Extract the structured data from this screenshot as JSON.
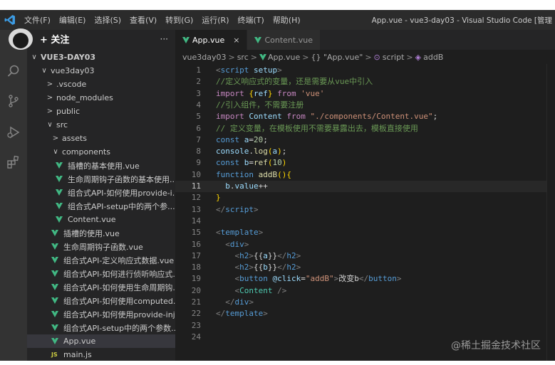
{
  "titlebar": {
    "menu": [
      "文件(F)",
      "编辑(E)",
      "选择(S)",
      "查看(V)",
      "转到(G)",
      "运行(R)",
      "终端(T)",
      "帮助(H)"
    ],
    "window_title": "App.vue - vue3-day03 - Visual Studio Code [管理"
  },
  "overlay": {
    "follow_label": "+ 关注"
  },
  "colors": {
    "vue_green": "#41b883",
    "accent": "#3c9be3",
    "background": "#1e1e1e"
  },
  "sidebar": {
    "more_label": "···",
    "rows": [
      {
        "label": "VUE3-DAY03",
        "chev": "∨",
        "indent": 4,
        "bold": true
      },
      {
        "label": "vue3day03",
        "chev": "∨",
        "indent": 18
      },
      {
        "label": ".vscode",
        "chev": ">",
        "indent": 26
      },
      {
        "label": "node_modules",
        "chev": ">",
        "indent": 26
      },
      {
        "label": "public",
        "chev": ">",
        "indent": 26
      },
      {
        "label": "src",
        "chev": "∨",
        "indent": 26
      },
      {
        "label": "assets",
        "chev": ">",
        "indent": 34
      },
      {
        "label": "components",
        "chev": "∨",
        "indent": 34
      },
      {
        "label": "插槽的基本使用.vue",
        "icon": "vue",
        "indent": 40
      },
      {
        "label": "生命周期钩子函数的基本使用...",
        "icon": "vue",
        "indent": 40
      },
      {
        "label": "组合式API-如何使用provide-i...",
        "icon": "vue",
        "indent": 40
      },
      {
        "label": "组合式API-setup中的两个参...",
        "icon": "vue",
        "indent": 40
      },
      {
        "label": "Content.vue",
        "icon": "vue",
        "indent": 40
      },
      {
        "label": "插槽的使用.vue",
        "icon": "vue",
        "indent": 34
      },
      {
        "label": "生命周期钩子函数.vue",
        "icon": "vue",
        "indent": 34
      },
      {
        "label": "组合式API-定义响应式数据.vue",
        "icon": "vue",
        "indent": 34
      },
      {
        "label": "组合式API-如何进行侦听响应式...",
        "icon": "vue",
        "indent": 34
      },
      {
        "label": "组合式API-如何使用生命周期钩...",
        "icon": "vue",
        "indent": 34
      },
      {
        "label": "组合式API-如何使用computed...",
        "icon": "vue",
        "indent": 34
      },
      {
        "label": "组合式API-如何使用provide-inj...",
        "icon": "vue",
        "indent": 34
      },
      {
        "label": "组合式API-setup中的两个参数...",
        "icon": "vue",
        "indent": 34
      },
      {
        "label": "App.vue",
        "icon": "vue",
        "indent": 34,
        "selected": true
      },
      {
        "label": "main.js",
        "icon": "js",
        "indent": 34
      }
    ]
  },
  "tabs": [
    {
      "label": "App.vue",
      "active": true,
      "close": "×"
    },
    {
      "label": "Content.vue",
      "active": false
    }
  ],
  "breadcrumb": [
    "vue3day03",
    "src",
    "App.vue",
    "{} \"App.vue\"",
    "script",
    "addB"
  ],
  "editor": {
    "current_line": 11,
    "lines": [
      [
        [
          "tk-gray",
          "<"
        ],
        [
          "tk-tag",
          "script"
        ],
        [
          "tk-attr",
          " setup"
        ],
        [
          "tk-gray",
          ">"
        ]
      ],
      [
        [
          "tk-com",
          "//定义响应式的变量，还是需要从vue中引入"
        ]
      ],
      [
        [
          "tk-kw2",
          "import"
        ],
        [
          "tk-plain",
          " "
        ],
        [
          "tk-brk",
          "{"
        ],
        [
          "tk-var",
          "ref"
        ],
        [
          "tk-brk",
          "}"
        ],
        [
          "tk-plain",
          " "
        ],
        [
          "tk-kw2",
          "from"
        ],
        [
          "tk-plain",
          " "
        ],
        [
          "tk-str",
          "'vue'"
        ]
      ],
      [
        [
          "tk-com",
          "//引入组件，不需要注册"
        ]
      ],
      [
        [
          "tk-kw2",
          "import"
        ],
        [
          "tk-plain",
          " "
        ],
        [
          "tk-var",
          "Content"
        ],
        [
          "tk-plain",
          " "
        ],
        [
          "tk-kw2",
          "from"
        ],
        [
          "tk-plain",
          " "
        ],
        [
          "tk-str",
          "\"./components/Content.vue\""
        ],
        [
          "tk-plain",
          ";"
        ]
      ],
      [
        [
          "tk-com",
          "// 定义变量，在模板使用不需要暴露出去，模板直接使用"
        ]
      ],
      [
        [
          "tk-kw",
          "const"
        ],
        [
          "tk-plain",
          " "
        ],
        [
          "tk-var",
          "a"
        ],
        [
          "tk-plain",
          "="
        ],
        [
          "tk-num",
          "20"
        ],
        [
          "tk-plain",
          ";"
        ]
      ],
      [
        [
          "tk-var",
          "console"
        ],
        [
          "tk-plain",
          "."
        ],
        [
          "tk-fn",
          "log"
        ],
        [
          "tk-brk",
          "("
        ],
        [
          "tk-var",
          "a"
        ],
        [
          "tk-brk",
          ")"
        ],
        [
          "tk-plain",
          ";"
        ]
      ],
      [
        [
          "tk-kw",
          "const"
        ],
        [
          "tk-plain",
          " "
        ],
        [
          "tk-var",
          "b"
        ],
        [
          "tk-plain",
          "="
        ],
        [
          "tk-fn",
          "ref"
        ],
        [
          "tk-brk",
          "("
        ],
        [
          "tk-num",
          "10"
        ],
        [
          "tk-brk",
          ")"
        ]
      ],
      [
        [
          "tk-kw",
          "function"
        ],
        [
          "tk-plain",
          " "
        ],
        [
          "tk-fn",
          "addB"
        ],
        [
          "tk-brk",
          "()"
        ],
        [
          "tk-brk",
          "{"
        ]
      ],
      [
        [
          "tk-plain",
          "  "
        ],
        [
          "tk-var",
          "b"
        ],
        [
          "tk-plain",
          "."
        ],
        [
          "tk-var",
          "value"
        ],
        [
          "tk-plain",
          "++"
        ]
      ],
      [
        [
          "tk-brk",
          "}"
        ]
      ],
      [
        [
          "tk-gray",
          "</"
        ],
        [
          "tk-tag",
          "script"
        ],
        [
          "tk-gray",
          ">"
        ]
      ],
      [],
      [
        [
          "tk-gray",
          "<"
        ],
        [
          "tk-tag",
          "template"
        ],
        [
          "tk-gray",
          ">"
        ]
      ],
      [
        [
          "tk-plain",
          "  "
        ],
        [
          "tk-gray",
          "<"
        ],
        [
          "tk-tag",
          "div"
        ],
        [
          "tk-gray",
          ">"
        ]
      ],
      [
        [
          "tk-plain",
          "    "
        ],
        [
          "tk-gray",
          "<"
        ],
        [
          "tk-tag",
          "h2"
        ],
        [
          "tk-gray",
          ">"
        ],
        [
          "tk-plain",
          "{{"
        ],
        [
          "tk-var",
          "a"
        ],
        [
          "tk-plain",
          "}}"
        ],
        [
          "tk-gray",
          "</"
        ],
        [
          "tk-tag",
          "h2"
        ],
        [
          "tk-gray",
          ">"
        ]
      ],
      [
        [
          "tk-plain",
          "    "
        ],
        [
          "tk-gray",
          "<"
        ],
        [
          "tk-tag",
          "h2"
        ],
        [
          "tk-gray",
          ">"
        ],
        [
          "tk-plain",
          "{{"
        ],
        [
          "tk-var",
          "b"
        ],
        [
          "tk-plain",
          "}}"
        ],
        [
          "tk-gray",
          "</"
        ],
        [
          "tk-tag",
          "h2"
        ],
        [
          "tk-gray",
          ">"
        ]
      ],
      [
        [
          "tk-plain",
          "    "
        ],
        [
          "tk-gray",
          "<"
        ],
        [
          "tk-tag",
          "button"
        ],
        [
          "tk-plain",
          " "
        ],
        [
          "tk-attr",
          "@click"
        ],
        [
          "tk-plain",
          "="
        ],
        [
          "tk-str",
          "\"addB\""
        ],
        [
          "tk-gray",
          ">"
        ],
        [
          "tk-plain",
          "改变b"
        ],
        [
          "tk-gray",
          "</"
        ],
        [
          "tk-tag",
          "button"
        ],
        [
          "tk-gray",
          ">"
        ]
      ],
      [
        [
          "tk-plain",
          "    "
        ],
        [
          "tk-gray",
          "<"
        ],
        [
          "tk-comp",
          "Content"
        ],
        [
          "tk-plain",
          " "
        ],
        [
          "tk-gray",
          "/>"
        ]
      ],
      [
        [
          "tk-plain",
          "  "
        ],
        [
          "tk-gray",
          "</"
        ],
        [
          "tk-tag",
          "div"
        ],
        [
          "tk-gray",
          ">"
        ]
      ],
      [
        [
          "tk-gray",
          "</"
        ],
        [
          "tk-tag",
          "template"
        ],
        [
          "tk-gray",
          ">"
        ]
      ],
      [],
      []
    ]
  },
  "watermark": "@稀土掘金技术社区"
}
